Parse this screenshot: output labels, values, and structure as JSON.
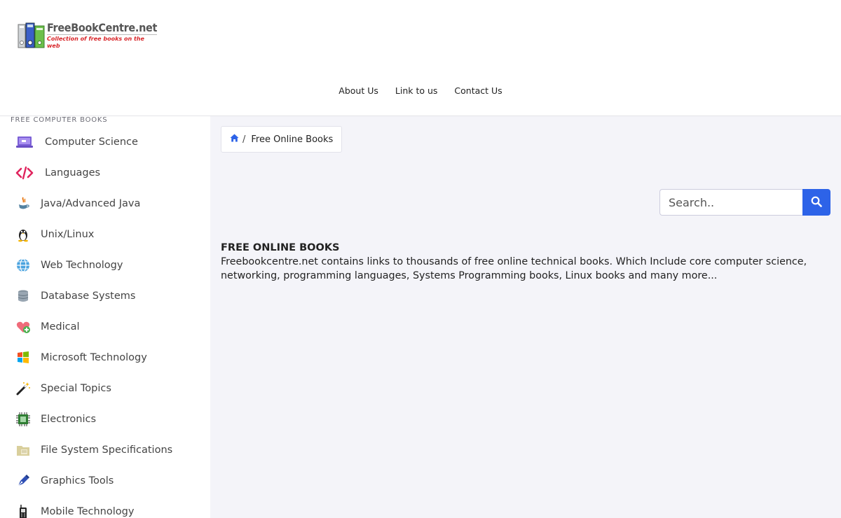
{
  "header": {
    "logo": {
      "name": "FreeBookCentre.net",
      "tagline": "Collection of free books on the web"
    },
    "nav": [
      {
        "label": "About Us"
      },
      {
        "label": "Link to us"
      },
      {
        "label": "Contact Us"
      }
    ]
  },
  "sidebar": {
    "heading": "FREE COMPUTER BOOKS",
    "items": [
      {
        "label": "Computer Science",
        "icon": "laptop-icon"
      },
      {
        "label": "Languages",
        "icon": "code-icon"
      },
      {
        "label": "Java/Advanced Java",
        "icon": "java-icon"
      },
      {
        "label": "Unix/Linux",
        "icon": "penguin-icon"
      },
      {
        "label": "Web Technology",
        "icon": "globe-icon"
      },
      {
        "label": "Database Systems",
        "icon": "database-icon"
      },
      {
        "label": "Medical",
        "icon": "heart-plus-icon"
      },
      {
        "label": "Microsoft Technology",
        "icon": "windows-icon"
      },
      {
        "label": "Special Topics",
        "icon": "magic-wand-icon"
      },
      {
        "label": "Electronics",
        "icon": "chip-icon"
      },
      {
        "label": "File System Specifications",
        "icon": "folder-icon"
      },
      {
        "label": "Graphics Tools",
        "icon": "pen-icon"
      },
      {
        "label": "Mobile Technology",
        "icon": "mobile-phone-icon"
      }
    ]
  },
  "breadcrumb": {
    "separator": "/",
    "current": "Free Online Books"
  },
  "search": {
    "placeholder": "Search.."
  },
  "intro": {
    "title": "FREE ONLINE BOOKS",
    "text": "Freebookcentre.net contains links to thousands of free online technical books. Which Include core computer science, networking, programming languages, Systems Programming books, Linux books and many more..."
  },
  "colors": {
    "accent": "#2d63e8",
    "main_bg": "#f4f4f9",
    "logo_red": "#d8262a"
  }
}
